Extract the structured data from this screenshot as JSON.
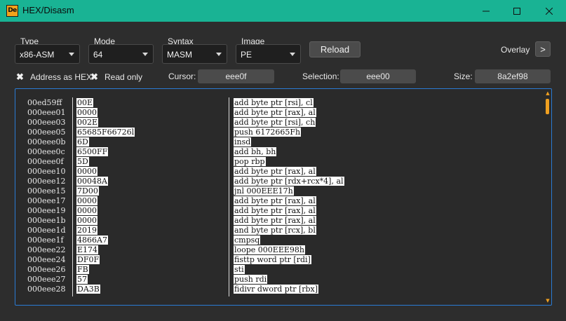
{
  "window": {
    "title": "HEX/Disasm",
    "icon_text": "De",
    "icons": {
      "minimize": "minimize-icon",
      "maximize": "maximize-icon",
      "close": "close-icon"
    },
    "accent_color": "#19b394"
  },
  "toolbar": {
    "type_label": "Type",
    "type_value": "x86-ASM",
    "mode_label": "Mode",
    "mode_value": "64",
    "syntax_label": "Syntax",
    "syntax_value": "MASM",
    "image_label": "Image",
    "image_value": "PE",
    "reload_label": "Reload",
    "overlay_label": "Overlay",
    "overlay_button": ">"
  },
  "options": {
    "address_as_hex": "Address as HEX",
    "read_only": "Read only",
    "check_mark": "✖",
    "cursor_label": "Cursor:",
    "cursor_value": "eee0f",
    "selection_label": "Selection:",
    "selection_value": "eee00",
    "size_label": "Size:",
    "size_value": "8a2ef98"
  },
  "rows": [
    {
      "addr": "00ed59ff",
      "hex": "00E",
      "asm": "add byte ptr [rsi], cl"
    },
    {
      "addr": "000eee01",
      "hex": "0000",
      "asm": "add byte ptr [rax], al"
    },
    {
      "addr": "000eee03",
      "hex": "002E",
      "asm": "add byte ptr [rsi], ch"
    },
    {
      "addr": "000eee05",
      "hex": "65685F66726l",
      "asm": "push 6172665Fh"
    },
    {
      "addr": "000eee0b",
      "hex": "6D",
      "asm": "insd"
    },
    {
      "addr": "000eee0c",
      "hex": "6500FF",
      "asm": "add bh, bh"
    },
    {
      "addr": "000eee0f",
      "hex": "5D",
      "asm": "pop rbp"
    },
    {
      "addr": "000eee10",
      "hex": "0000",
      "asm": "add byte ptr [rax], al"
    },
    {
      "addr": "000eee12",
      "hex": "00048A",
      "asm": "add byte ptr [rdx+rcx*4], al"
    },
    {
      "addr": "000eee15",
      "hex": "7D00",
      "asm": "jnl 000EEE17h"
    },
    {
      "addr": "000eee17",
      "hex": "0000",
      "asm": "add byte ptr [rax], al"
    },
    {
      "addr": "000eee19",
      "hex": "0000",
      "asm": "add byte ptr [rax], al"
    },
    {
      "addr": "000eee1b",
      "hex": "0000",
      "asm": "add byte ptr [rax], al"
    },
    {
      "addr": "000eee1d",
      "hex": "2019",
      "asm": "and byte ptr [rcx], bl"
    },
    {
      "addr": "000eee1f",
      "hex": "4866A7",
      "asm": "cmpsq"
    },
    {
      "addr": "000eee22",
      "hex": "E174",
      "asm": "loope 000EEE98h"
    },
    {
      "addr": "000eee24",
      "hex": "DF0F",
      "asm": "fisttp word ptr [rdi]"
    },
    {
      "addr": "000eee26",
      "hex": "FB",
      "asm": "sti"
    },
    {
      "addr": "000eee27",
      "hex": "57",
      "asm": "push rdi"
    },
    {
      "addr": "000eee28",
      "hex": "DA3B",
      "asm": "fidivr dword ptr [rbx]"
    }
  ],
  "scrollbar": {
    "up_icon": "▲",
    "down_icon": "▼",
    "accent_color": "#f0a020"
  }
}
